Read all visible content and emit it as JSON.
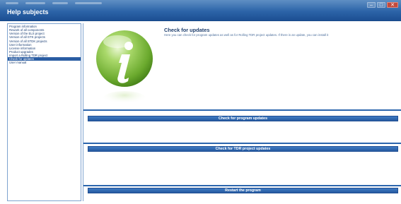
{
  "window": {
    "title": "Help subjects",
    "controls": [
      "–",
      "□",
      "✕"
    ]
  },
  "sidebar": {
    "items": [
      {
        "label": "Program information",
        "selected": false
      },
      {
        "label": "Rework of all components",
        "selected": false
      },
      {
        "label": "Version of the ELS project",
        "selected": false
      },
      {
        "label": "Version of all GTK projects",
        "selected": false
      },
      {
        "label": "Version of all STDK projects",
        "selected": false
      },
      {
        "label": "User information",
        "selected": false
      },
      {
        "label": "License information",
        "selected": false
      },
      {
        "label": "Product upgrades",
        "selected": false
      },
      {
        "label": "Import a Rolling TDR project",
        "selected": false
      },
      {
        "label": "Check for updates",
        "selected": true
      },
      {
        "label": "User manual",
        "selected": false
      }
    ]
  },
  "main": {
    "icon": "info-icon",
    "heading": "Check for updates",
    "description": "Here you can check for program updates as well as for Rolling TDR project updates. If there is an update, you can install it",
    "buttons": {
      "program_updates": "Check for program updates",
      "tdr_updates": "Check for TDR project updates",
      "restart": "Restart the program"
    }
  },
  "colors": {
    "accent": "#2c66ad",
    "titlebar": "#2c64a8",
    "selected": "#2a5da3",
    "icon_green": "#7fbf3f"
  }
}
